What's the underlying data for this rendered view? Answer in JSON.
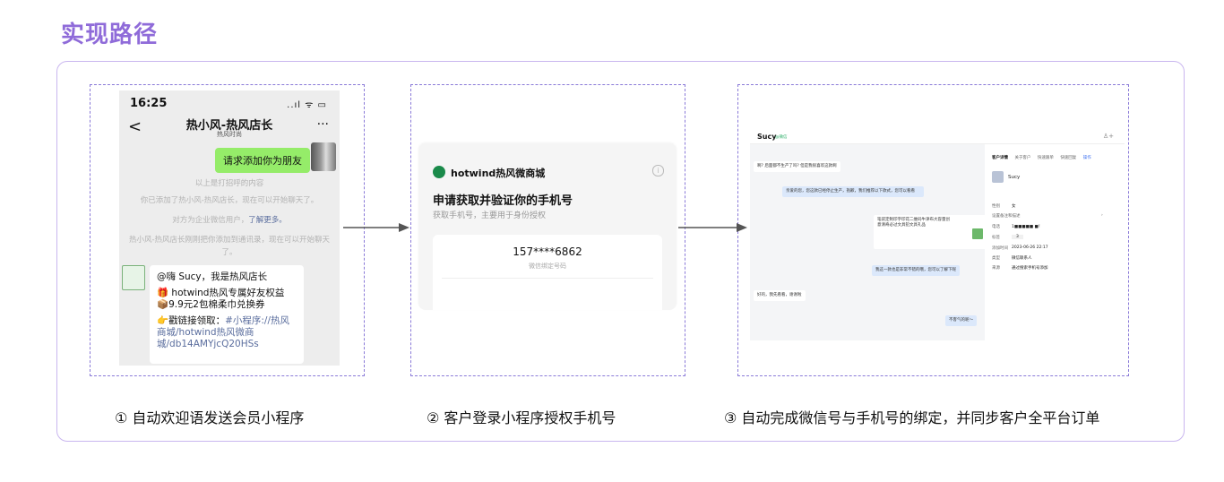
{
  "page_title": "实现路径",
  "steps": [
    {
      "caption": "① 自动欢迎语发送会员小程序"
    },
    {
      "caption": "② 客户登录小程序授权手机号"
    },
    {
      "caption": "③ 自动完成微信号与手机号的绑定，并同步客户全平台订单"
    }
  ],
  "phone1": {
    "time": "16:25",
    "signal": "..ıl ᯤ ▭",
    "back": "<",
    "chat_title": "热小风-热风店长",
    "chat_subtitle": "热风时尚",
    "more": "···",
    "my_message": "请求添加你为朋友",
    "sys1": "以上是打招呼的内容",
    "sys2": "你已添加了热小风-热风店长，现在可以开始聊天了。",
    "sys3_prefix": "对方为企业微信用户，",
    "sys3_link": "了解更多。",
    "sys4": "热小风-热风店长刚刚把你添加到通讯录，现在可以开始聊天了。",
    "welcome_line1": "@嗨 Sucy，我是热风店长",
    "welcome_line2": "🎁 hotwind热风专属好友权益",
    "welcome_line3": "📦9.9元2包棉柔巾兑换券",
    "welcome_link_prefix": "👉戳链接领取：",
    "welcome_link": "#小程序://热风商城/hotwind热风微商城/db14AMYjcQ20HSs"
  },
  "phone2": {
    "shop_name": "hotwind热风微商城",
    "info_icon": "i",
    "heading": "申请获取并验证你的手机号",
    "subheading": "获取手机号，主要用于身份授权",
    "phone_number": "157****6862",
    "phone_note": "微信绑定号码"
  },
  "crm": {
    "contact_name": "Sucy",
    "contact_source": "@微信",
    "user_icon": "♙+",
    "messages": [
      {
        "side": "left",
        "text": "啊? 后面都不生产了吗? 但是我很喜欢这款啊"
      },
      {
        "side": "right",
        "text": "亲爱的您，您这款已经停止生产，抱歉，我们推荐以下款式，您可以看看"
      },
      {
        "side": "right",
        "text": "笔袋定制印字印花二维码牛津布大容量创意清奇必过文具铅文具礼品"
      },
      {
        "side": "right",
        "text": "我这一款也是非常不错的哦，您可以了解下呢"
      },
      {
        "side": "left",
        "text": "好的，我先看看，谢谢啦"
      },
      {
        "side": "right",
        "text": "不客气的呢～"
      }
    ],
    "tabs": [
      "客户详情",
      "关于客户",
      "快速跟单",
      "快速回复",
      "操作"
    ],
    "profile_name": "Sucy",
    "fields": [
      {
        "label": "性别",
        "value": "女"
      },
      {
        "label": "设置备注和描述",
        "value": ""
      },
      {
        "label": "电话",
        "value": "1■■■■■ ■！"
      },
      {
        "label": "标签",
        "value": "3"
      },
      {
        "label": "添加时间",
        "value": "2023-06-26 22:17"
      },
      {
        "label": "类型",
        "value": "微信联系人"
      },
      {
        "label": "来源",
        "value": "通过搜索手机号添加"
      }
    ]
  }
}
